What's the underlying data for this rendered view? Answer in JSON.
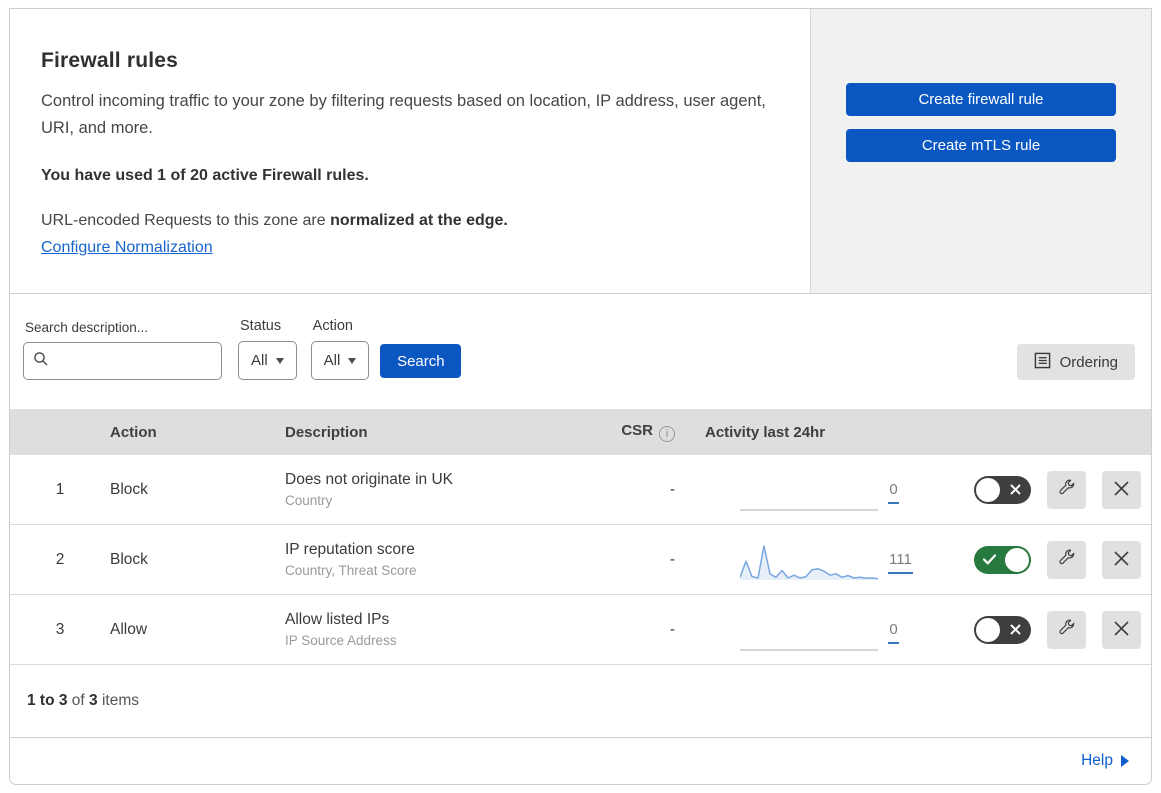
{
  "panel": {
    "title": "Firewall rules",
    "description": "Control incoming traffic to your zone by filtering requests based on location, IP address, user agent, URI, and more.",
    "usage": "You have used 1 of 20 active Firewall rules.",
    "normalization": {
      "prefix": "URL-encoded Requests to this zone are ",
      "bold": "normalized at the edge."
    },
    "link": "Configure Normalization",
    "create_firewall_button": "Create firewall rule",
    "create_mtls_button": "Create mTLS rule"
  },
  "filters": {
    "search_label": "Search description...",
    "search_value": "",
    "status_label": "Status",
    "status_value": "All",
    "action_label": "Action",
    "action_value": "All",
    "search_button": "Search",
    "ordering_button": "Ordering"
  },
  "table": {
    "headers": {
      "index": "",
      "action": "Action",
      "description": "Description",
      "csr": "CSR",
      "csr_info": "i",
      "activity": "Activity last 24hr"
    },
    "rows": [
      {
        "num": "1",
        "action": "Block",
        "desc": "Does not originate in UK",
        "criteria": "Country",
        "csr": "-",
        "count": "0",
        "enabled": false,
        "activity": [
          0,
          0,
          0,
          0,
          0,
          0,
          0,
          0,
          0,
          0,
          0,
          0,
          0,
          0,
          0,
          0,
          0,
          0,
          0,
          0,
          0,
          0,
          0,
          0
        ]
      },
      {
        "num": "2",
        "action": "Block",
        "desc": "IP reputation score",
        "criteria": "Country, Threat Score",
        "csr": "-",
        "count": "111",
        "enabled": true,
        "activity": [
          8,
          55,
          10,
          6,
          100,
          18,
          8,
          28,
          6,
          14,
          6,
          10,
          30,
          33,
          26,
          14,
          18,
          8,
          13,
          6,
          8,
          5,
          6,
          4
        ]
      },
      {
        "num": "3",
        "action": "Allow",
        "desc": "Allow listed IPs",
        "criteria": "IP Source Address",
        "csr": "-",
        "count": "0",
        "enabled": false,
        "activity": [
          0,
          0,
          0,
          0,
          0,
          0,
          0,
          0,
          0,
          0,
          0,
          0,
          0,
          0,
          0,
          0,
          0,
          0,
          0,
          0,
          0,
          0,
          0,
          0
        ]
      }
    ],
    "summary": {
      "range": "1 to 3",
      "of": "of",
      "total": "3",
      "items": "items"
    }
  },
  "help": {
    "label": "Help"
  },
  "icons": {
    "search": "magnifier",
    "ordering": "list-document",
    "info": "circled-i",
    "toggle_on": "check",
    "toggle_off": "cross",
    "edit": "wrench",
    "delete": "x",
    "help_arrow": "right-triangle"
  },
  "colors": {
    "primary_blue": "#0b57c2",
    "link_blue": "#1765cc",
    "toggle_green": "#26793f",
    "toggle_dark": "#3f3f3f",
    "spark_line": "#7aa7e0",
    "spark_fill": "rgba(122,167,224,0.18)",
    "spark_flat": "#c7c7c7",
    "header_gray": "#dedede",
    "panel_gray": "#f1f1f1"
  }
}
